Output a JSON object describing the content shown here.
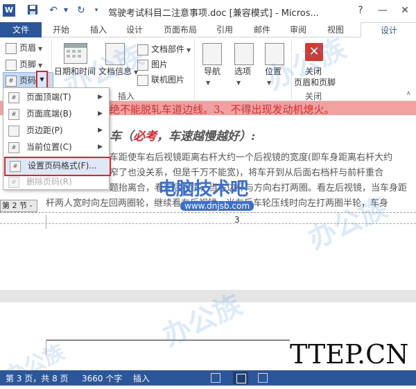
{
  "titlebar": {
    "title": "驾驶考试科目二注意事项.doc [兼容模式] - Micros...",
    "help": "?",
    "minimize": "—",
    "close": "✕"
  },
  "tabs": {
    "file": "文件",
    "items": [
      "开始",
      "插入",
      "设计",
      "页面布局",
      "引用",
      "邮件",
      "审阅",
      "视图"
    ],
    "design": "设计"
  },
  "ribbon": {
    "header": "页眉",
    "footer": "页脚",
    "page_number": "页码",
    "datetime": "日期和时间",
    "docinfo": "文档信息",
    "doc_parts": "文档部件",
    "picture": "图片",
    "online_picture": "联机图片",
    "nav": "导航",
    "options": "选项",
    "position": "位置",
    "close_line1": "关闭",
    "close_line2": "页眉和页脚",
    "group_insert": "插入",
    "group_close": "关闭"
  },
  "menu": {
    "items": [
      {
        "label": "页面顶端(T)",
        "submenu": true
      },
      {
        "label": "页面底端(B)",
        "submenu": true
      },
      {
        "label": "页边距(P)",
        "submenu": true
      },
      {
        "label": "当前位置(C)",
        "submenu": true
      },
      {
        "label": "设置页码格式(F)...",
        "submenu": false
      },
      {
        "label": "删除页码(R)",
        "submenu": false
      }
    ]
  },
  "document": {
    "red_line": "绝不能脱轧车道边线。3、不得出现发动机熄火。",
    "heading_a": "车（",
    "heading_b": "必考",
    "heading_c": "，车速越慢越好）:",
    "line1": "车距使车右后视镜距离右杆大约一个后视镜的宽度(即车身距离右杆大约",
    "line2": "窄了也没关系，但是千万不能宽)，将车开到从后面右档杆与前杆重合",
    "line3": "题抬离合，看左后视镜，当左边杆与方向右打两圈。看左后视镜，当车身距",
    "line4": "杆两人宽时向左回两圈轮，继续看左后视镜，当左后车轮压线时向左打两圈半轮，车身",
    "section_tag": "第 2 节 -",
    "page_num": "3"
  },
  "watermarks": {
    "brand": "电脑技术吧",
    "url": "www.dnjsb.com",
    "ttep": "TTEP.CN"
  },
  "statusbar": {
    "page": "第 3 页，共 8 页",
    "words": "3660 个字",
    "mode": "插入"
  }
}
